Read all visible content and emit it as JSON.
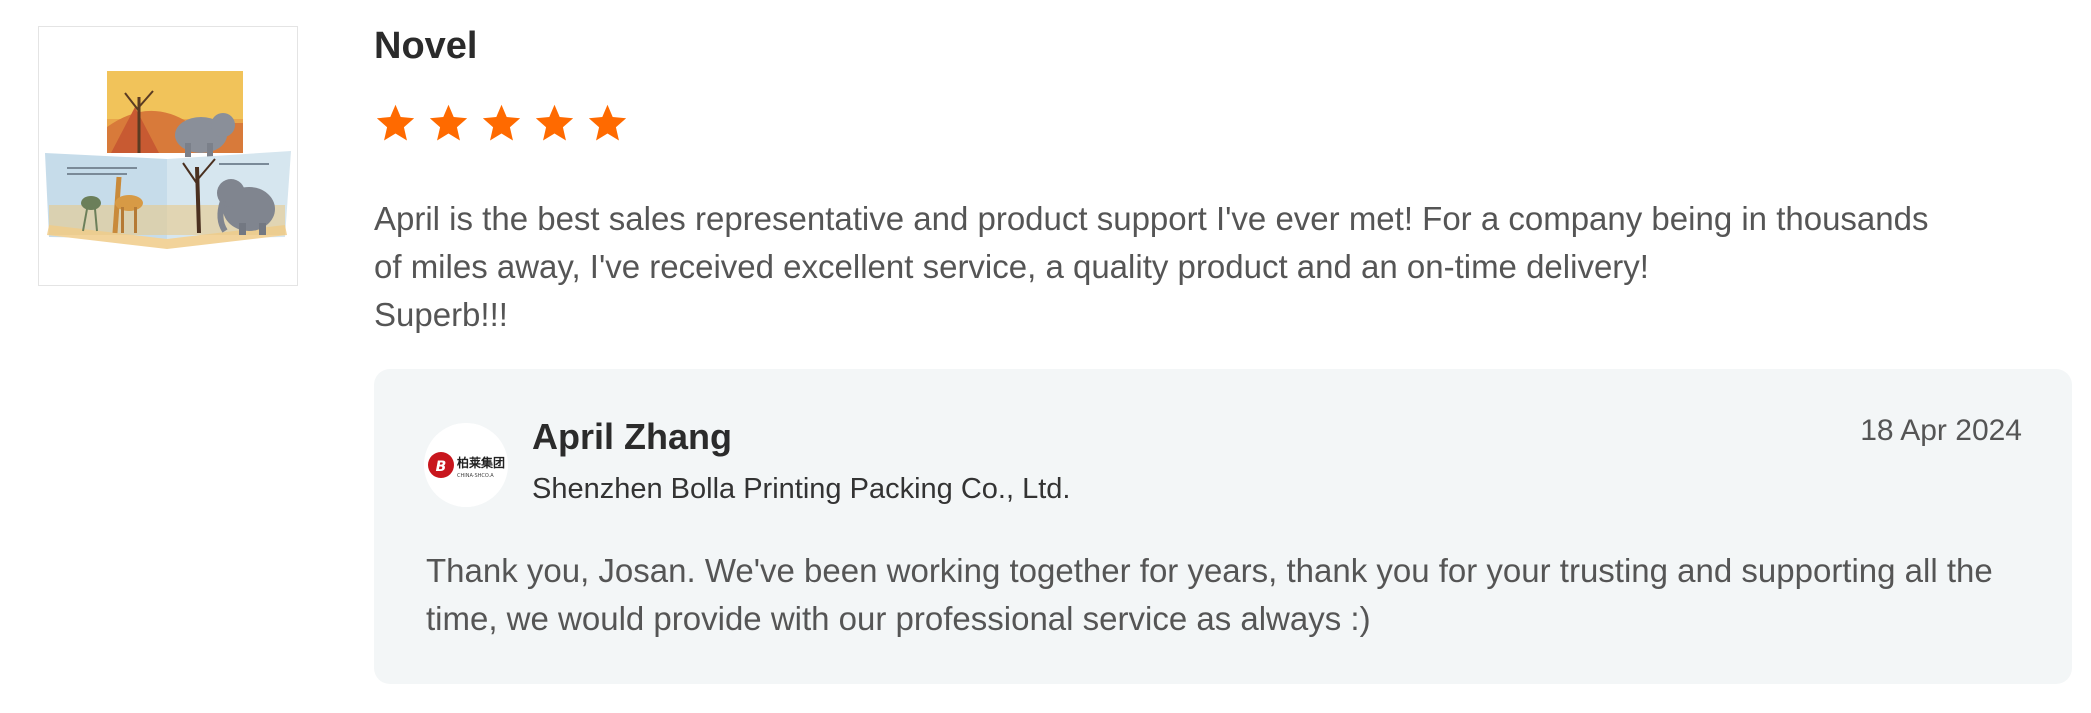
{
  "product": {
    "name": "Novel",
    "image": "children-picture-book-product-photo"
  },
  "review": {
    "rating": 5,
    "max_rating": 5,
    "star_color": "#ff6a00",
    "text": "April is the best sales representative and product support I've ever met! For a company being in thousands\nof miles away, I've received excellent service, a quality product and an on-time delivery!\nSuperb!!!"
  },
  "reply": {
    "seller_name": "April Zhang",
    "seller_company": "Shenzhen Bolla Printing Packing Co., Ltd.",
    "date": "18 Apr 2024",
    "text": "Thank you, Josan. We've been working together for years, thank you for your trusting and supporting all the time, we would provide with our professional service as always :)",
    "logo": {
      "chinese_text": "柏莱集团",
      "english_text": "CHINA·SHCO.A",
      "brand_color": "#c8161d"
    },
    "background": "#f3f6f7"
  }
}
